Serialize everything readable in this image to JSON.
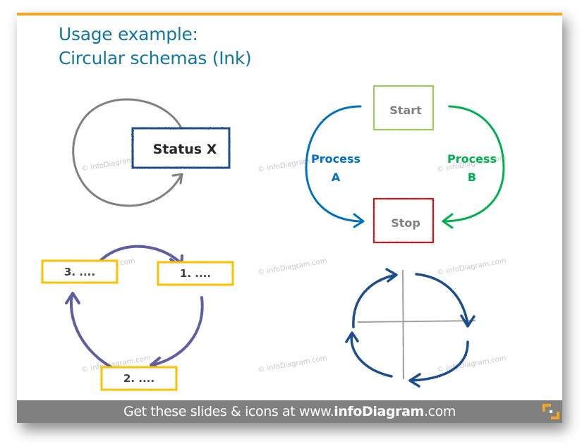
{
  "slide": {
    "title_line1": "Usage example:",
    "title_line2": "Circular schemas (Ink)",
    "accent_color": "#f6a623",
    "title_color": "#11779f"
  },
  "diagrams": {
    "status_cycle": {
      "box_label": "Status X",
      "arrow_color": "#808080",
      "box_border_color": "#1f4e8c"
    },
    "start_stop": {
      "start_label": "Start",
      "stop_label": "Stop",
      "process_a_line1": "Process",
      "process_a_line2": "A",
      "process_b_line1": "Process",
      "process_b_line2": "B",
      "start_color": "#92d050",
      "stop_color": "#ff0000",
      "process_a_color": "#0070c0",
      "process_b_color": "#00b050"
    },
    "three_step": {
      "steps": [
        "1. ....",
        "2. ....",
        "3. ...."
      ],
      "arrow_color": "#5f5f9f",
      "box_color": "#ffc000"
    },
    "four_quadrant": {
      "arrow_color": "#1f4e8c",
      "axis_color": "#a0a0a0"
    }
  },
  "watermark": "© infoDiagram.com",
  "footer": {
    "prefix": "Get these slides & icons at www.",
    "brand": "infoDiagram",
    "suffix": ".com",
    "logo_icon": "infodiagram-logo-icon"
  }
}
